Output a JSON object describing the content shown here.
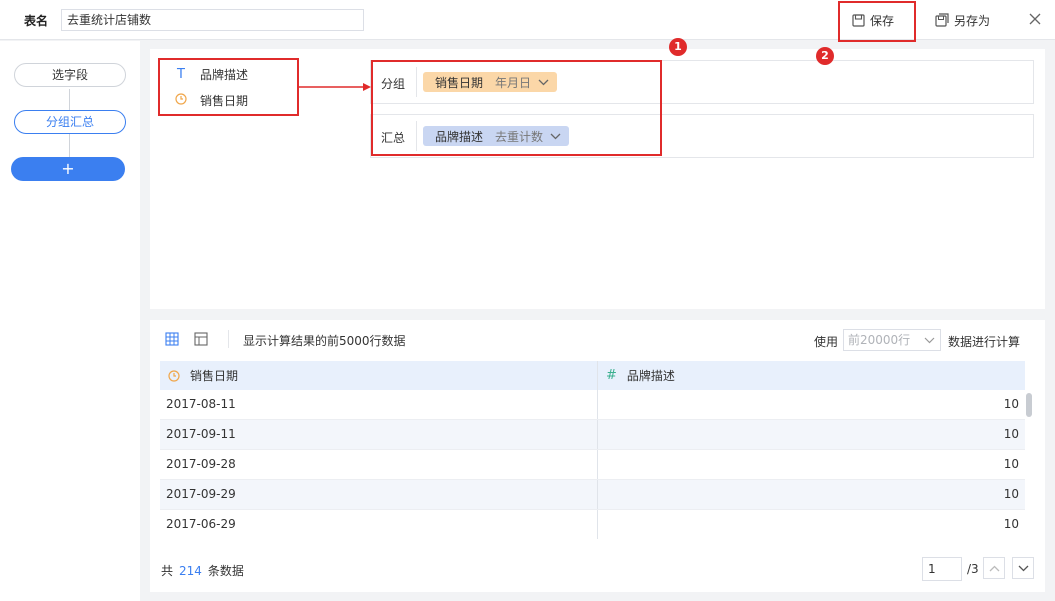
{
  "header": {
    "name_label": "表名",
    "name_value": "去重统计店铺数",
    "save_label": "保存",
    "save_as_label": "另存为"
  },
  "annotations": {
    "badge_1": "1",
    "badge_2": "2"
  },
  "steps": {
    "select_fields": "选字段",
    "group_summary": "分组汇总",
    "add": "+"
  },
  "fields": [
    {
      "label": "品牌描述",
      "icon": "text-type-icon",
      "icon_glyph": "T"
    },
    {
      "label": "销售日期",
      "icon": "clock-icon"
    }
  ],
  "group_zone": {
    "label": "分组",
    "chip_name": "销售日期",
    "chip_agg": "年月日"
  },
  "summary_zone": {
    "label": "汇总",
    "chip_name": "品牌描述",
    "chip_agg": "去重计数"
  },
  "result": {
    "note": "显示计算结果的前5000行数据",
    "use_label": "使用",
    "row_limit": "前20000行",
    "use_suffix": "数据进行计算",
    "columns": [
      {
        "label": "销售日期",
        "icon": "clock-icon"
      },
      {
        "label": "品牌描述",
        "icon": "hash-icon",
        "icon_glyph": "#"
      }
    ],
    "rows": [
      [
        "2017-08-11",
        "10"
      ],
      [
        "2017-09-11",
        "10"
      ],
      [
        "2017-09-28",
        "10"
      ],
      [
        "2017-09-29",
        "10"
      ],
      [
        "2017-06-29",
        "10"
      ]
    ],
    "total_prefix": "共",
    "total_count": "214",
    "total_suffix": "条数据",
    "current_page": "1",
    "total_pages": "/3"
  },
  "colors": {
    "accent": "#3b7ff0",
    "callout": "#e02b2b",
    "group_chip": "#fbd7a8",
    "summary_chip": "#c9d6f2"
  }
}
